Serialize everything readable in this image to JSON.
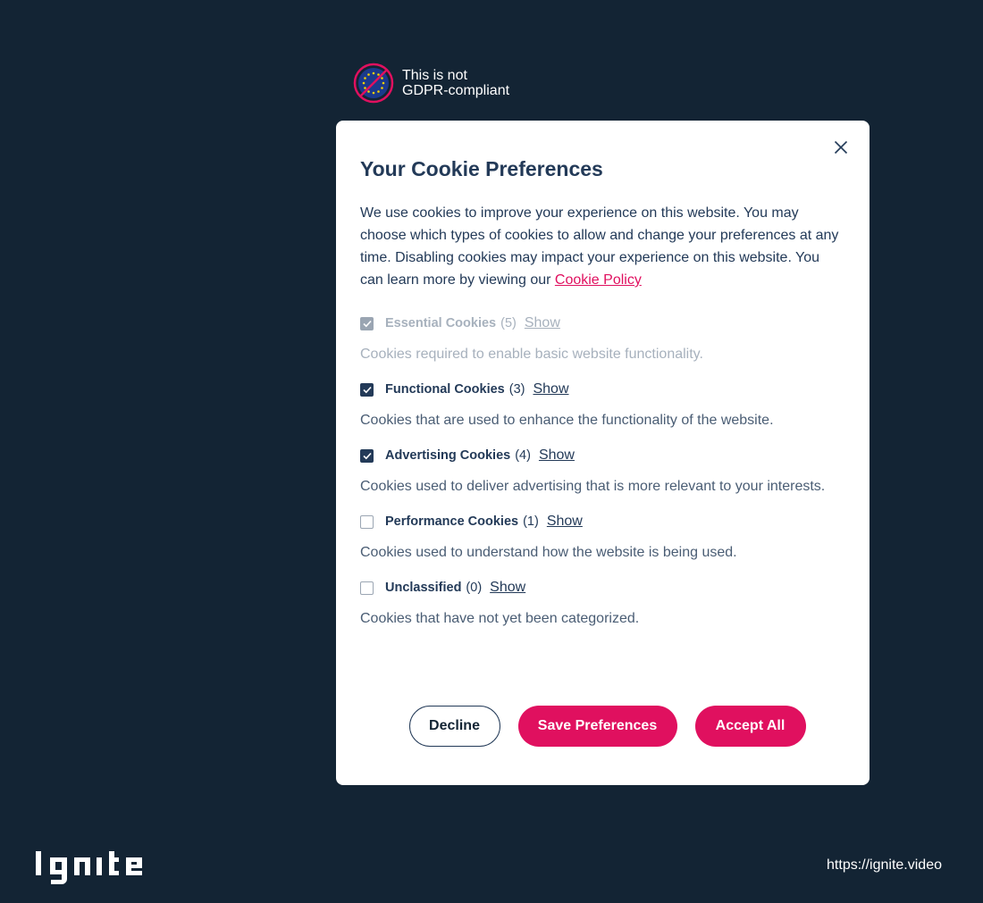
{
  "badge": {
    "line1": "This is not",
    "line2": "GDPR-compliant"
  },
  "modal": {
    "title": "Your Cookie Preferences",
    "intro": "We use cookies to improve your experience on this website. You may choose which types of cookies to allow and change your preferences at any time. Disabling cookies may impact your experience on this website. You can learn more by viewing our ",
    "policy_link": "Cookie Policy",
    "show_label": "Show",
    "categories": [
      {
        "name": "Essential Cookies",
        "count": "(5)",
        "description": "Cookies required to enable basic website functionality.",
        "checked": true,
        "disabled": true
      },
      {
        "name": "Functional Cookies",
        "count": "(3)",
        "description": "Cookies that are used to enhance the functionality of the website.",
        "checked": true,
        "disabled": false
      },
      {
        "name": "Advertising Cookies",
        "count": "(4)",
        "description": "Cookies used to deliver advertising that is more relevant to your interests.",
        "checked": true,
        "disabled": false
      },
      {
        "name": "Performance Cookies",
        "count": "(1)",
        "description": "Cookies used to understand how the website is being used.",
        "checked": false,
        "disabled": false
      },
      {
        "name": "Unclassified",
        "count": "(0)",
        "description": "Cookies that have not yet been categorized.",
        "checked": false,
        "disabled": false
      }
    ],
    "buttons": {
      "decline": "Decline",
      "save": "Save Preferences",
      "accept": "Accept All"
    }
  },
  "footer": {
    "logo_text": "ignite",
    "url": "https://ignite.video"
  },
  "colors": {
    "background": "#132434",
    "accent": "#e0105f",
    "text": "#233a58",
    "modal": "#ffffff"
  }
}
